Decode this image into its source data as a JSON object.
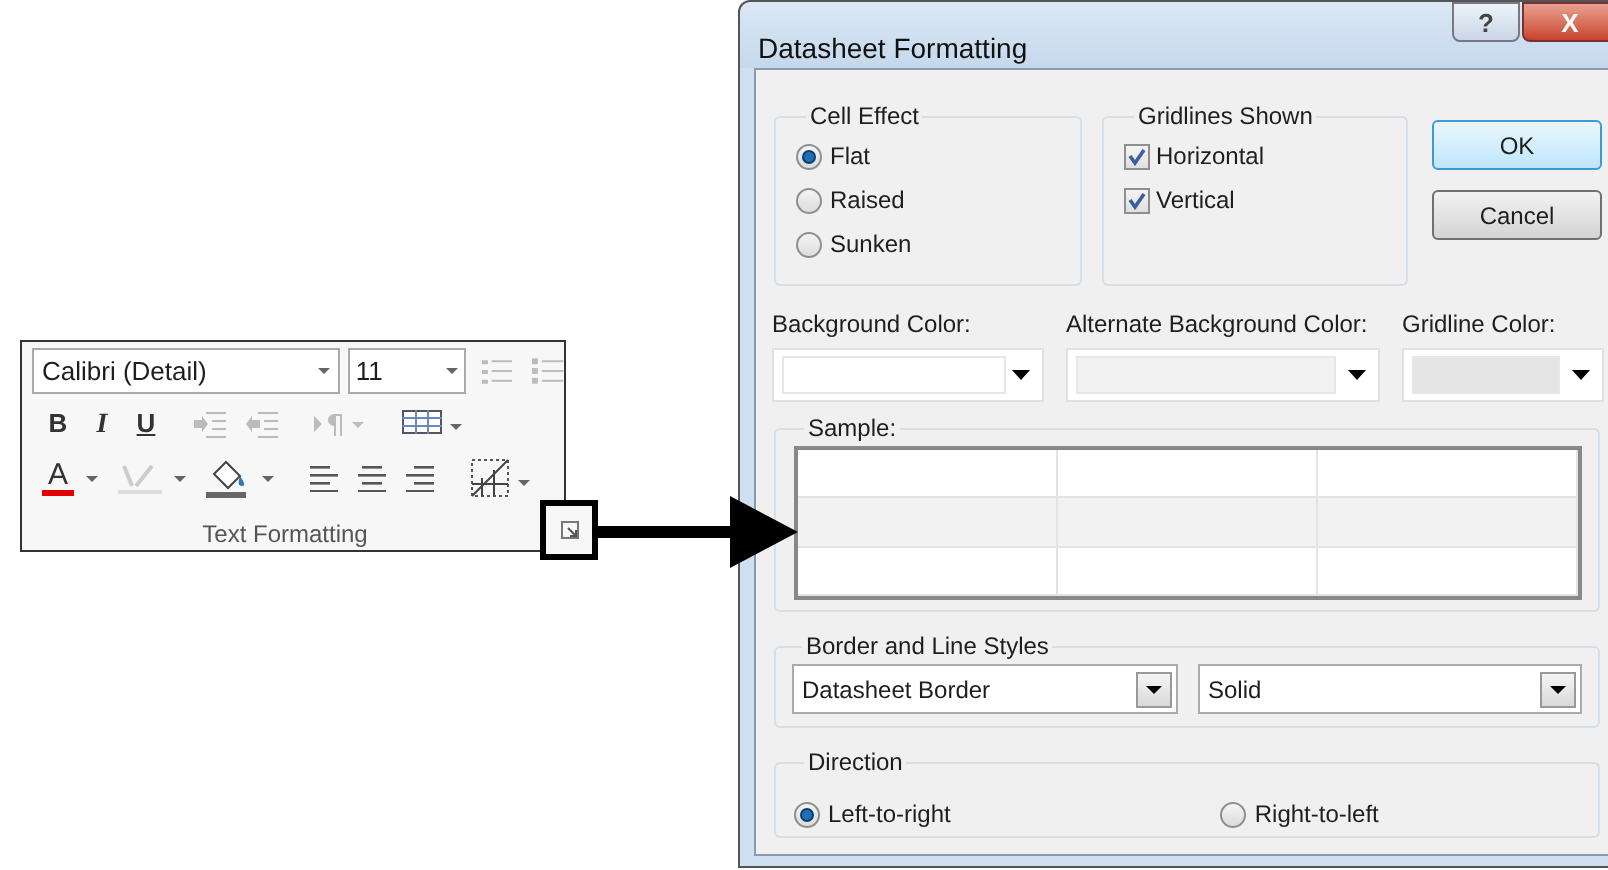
{
  "ribbon_group": {
    "font_name": "Calibri (Detail)",
    "font_size": "11",
    "bold": "B",
    "italic": "I",
    "underline": "U",
    "font_color": "A",
    "label": "Text Formatting"
  },
  "dialog": {
    "title": "Datasheet Formatting",
    "help": "?",
    "close": "X",
    "cell_effect": {
      "title": "Cell Effect",
      "options": [
        {
          "label": "Flat",
          "selected": true
        },
        {
          "label": "Raised",
          "selected": false
        },
        {
          "label": "Sunken",
          "selected": false
        }
      ]
    },
    "gridlines": {
      "title": "Gridlines Shown",
      "options": [
        {
          "label": "Horizontal",
          "checked": true
        },
        {
          "label": "Vertical",
          "checked": true
        }
      ]
    },
    "buttons": [
      "OK",
      "Cancel"
    ],
    "color_pickers": [
      {
        "label": "Background Color:",
        "color": "#ffffff"
      },
      {
        "label": "Alternate Background Color:",
        "color": "#f2f2f2"
      },
      {
        "label": "Gridline Color:",
        "color": "#e4e4e4"
      }
    ],
    "sample": {
      "title": "Sample:"
    },
    "border_styles": {
      "title": "Border and Line Styles",
      "dropdowns": [
        "Datasheet Border",
        "Solid"
      ]
    },
    "direction": {
      "title": "Direction",
      "options": [
        {
          "label": "Left-to-right",
          "selected": true
        },
        {
          "label": "Right-to-left",
          "selected": false
        }
      ]
    }
  }
}
